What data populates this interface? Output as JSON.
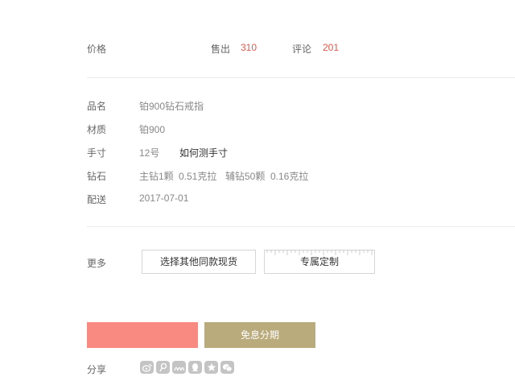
{
  "stats": {
    "price_label": "价格",
    "sold_label": "售出",
    "sold_value": "310",
    "review_label": "评论",
    "review_value": "201"
  },
  "specs": {
    "name_label": "品名",
    "name_value": "铂900钻石戒指",
    "material_label": "材质",
    "material_value": "铂900",
    "size_label": "手寸",
    "size_value": "12号",
    "size_link": "如何测手寸",
    "diamond_label": "钻石",
    "diamond_main": "主钻1颗",
    "diamond_main_weight": "0.51克拉",
    "diamond_side": "辅钻50颗",
    "diamond_side_weight": "0.16克拉",
    "delivery_label": "配送",
    "delivery_value": "2017-07-01"
  },
  "more": {
    "label": "更多",
    "other_stock_button": "选择其他同款现货",
    "custom_button": "专属定制"
  },
  "actions": {
    "buy_button": "",
    "installment_button": "免息分期"
  },
  "share": {
    "label": "分享",
    "icons": [
      "weibo-icon",
      "tencent-weibo-icon",
      "renren-icon",
      "qq-icon",
      "qzone-icon",
      "wechat-icon"
    ]
  },
  "colors": {
    "accent": "#e05a4f",
    "pink_button": "#f88a82",
    "gold_button": "#b9ab7c",
    "icon_gray": "#c4c4c4"
  }
}
